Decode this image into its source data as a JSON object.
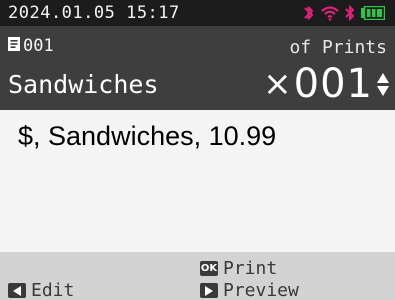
{
  "status_bar": {
    "datetime": "2024.01.05 15:17",
    "icons": [
      "bluetooth-logo-icon",
      "wifi-icon",
      "bluetooth-icon",
      "battery-icon"
    ],
    "icon_color": "#e0207a",
    "battery_color": "#2ec44a"
  },
  "header": {
    "doc_icon": "document-icon",
    "doc_number": "001",
    "prints_label": "of Prints",
    "product_name": "Sandwiches",
    "qty_prefix": "×",
    "qty_value": "001"
  },
  "content": {
    "record_text": "$, Sandwiches, 10.99"
  },
  "softkeys": {
    "edit_label": "Edit",
    "print_key": "OK",
    "print_label": "Print",
    "preview_label": "Preview"
  }
}
